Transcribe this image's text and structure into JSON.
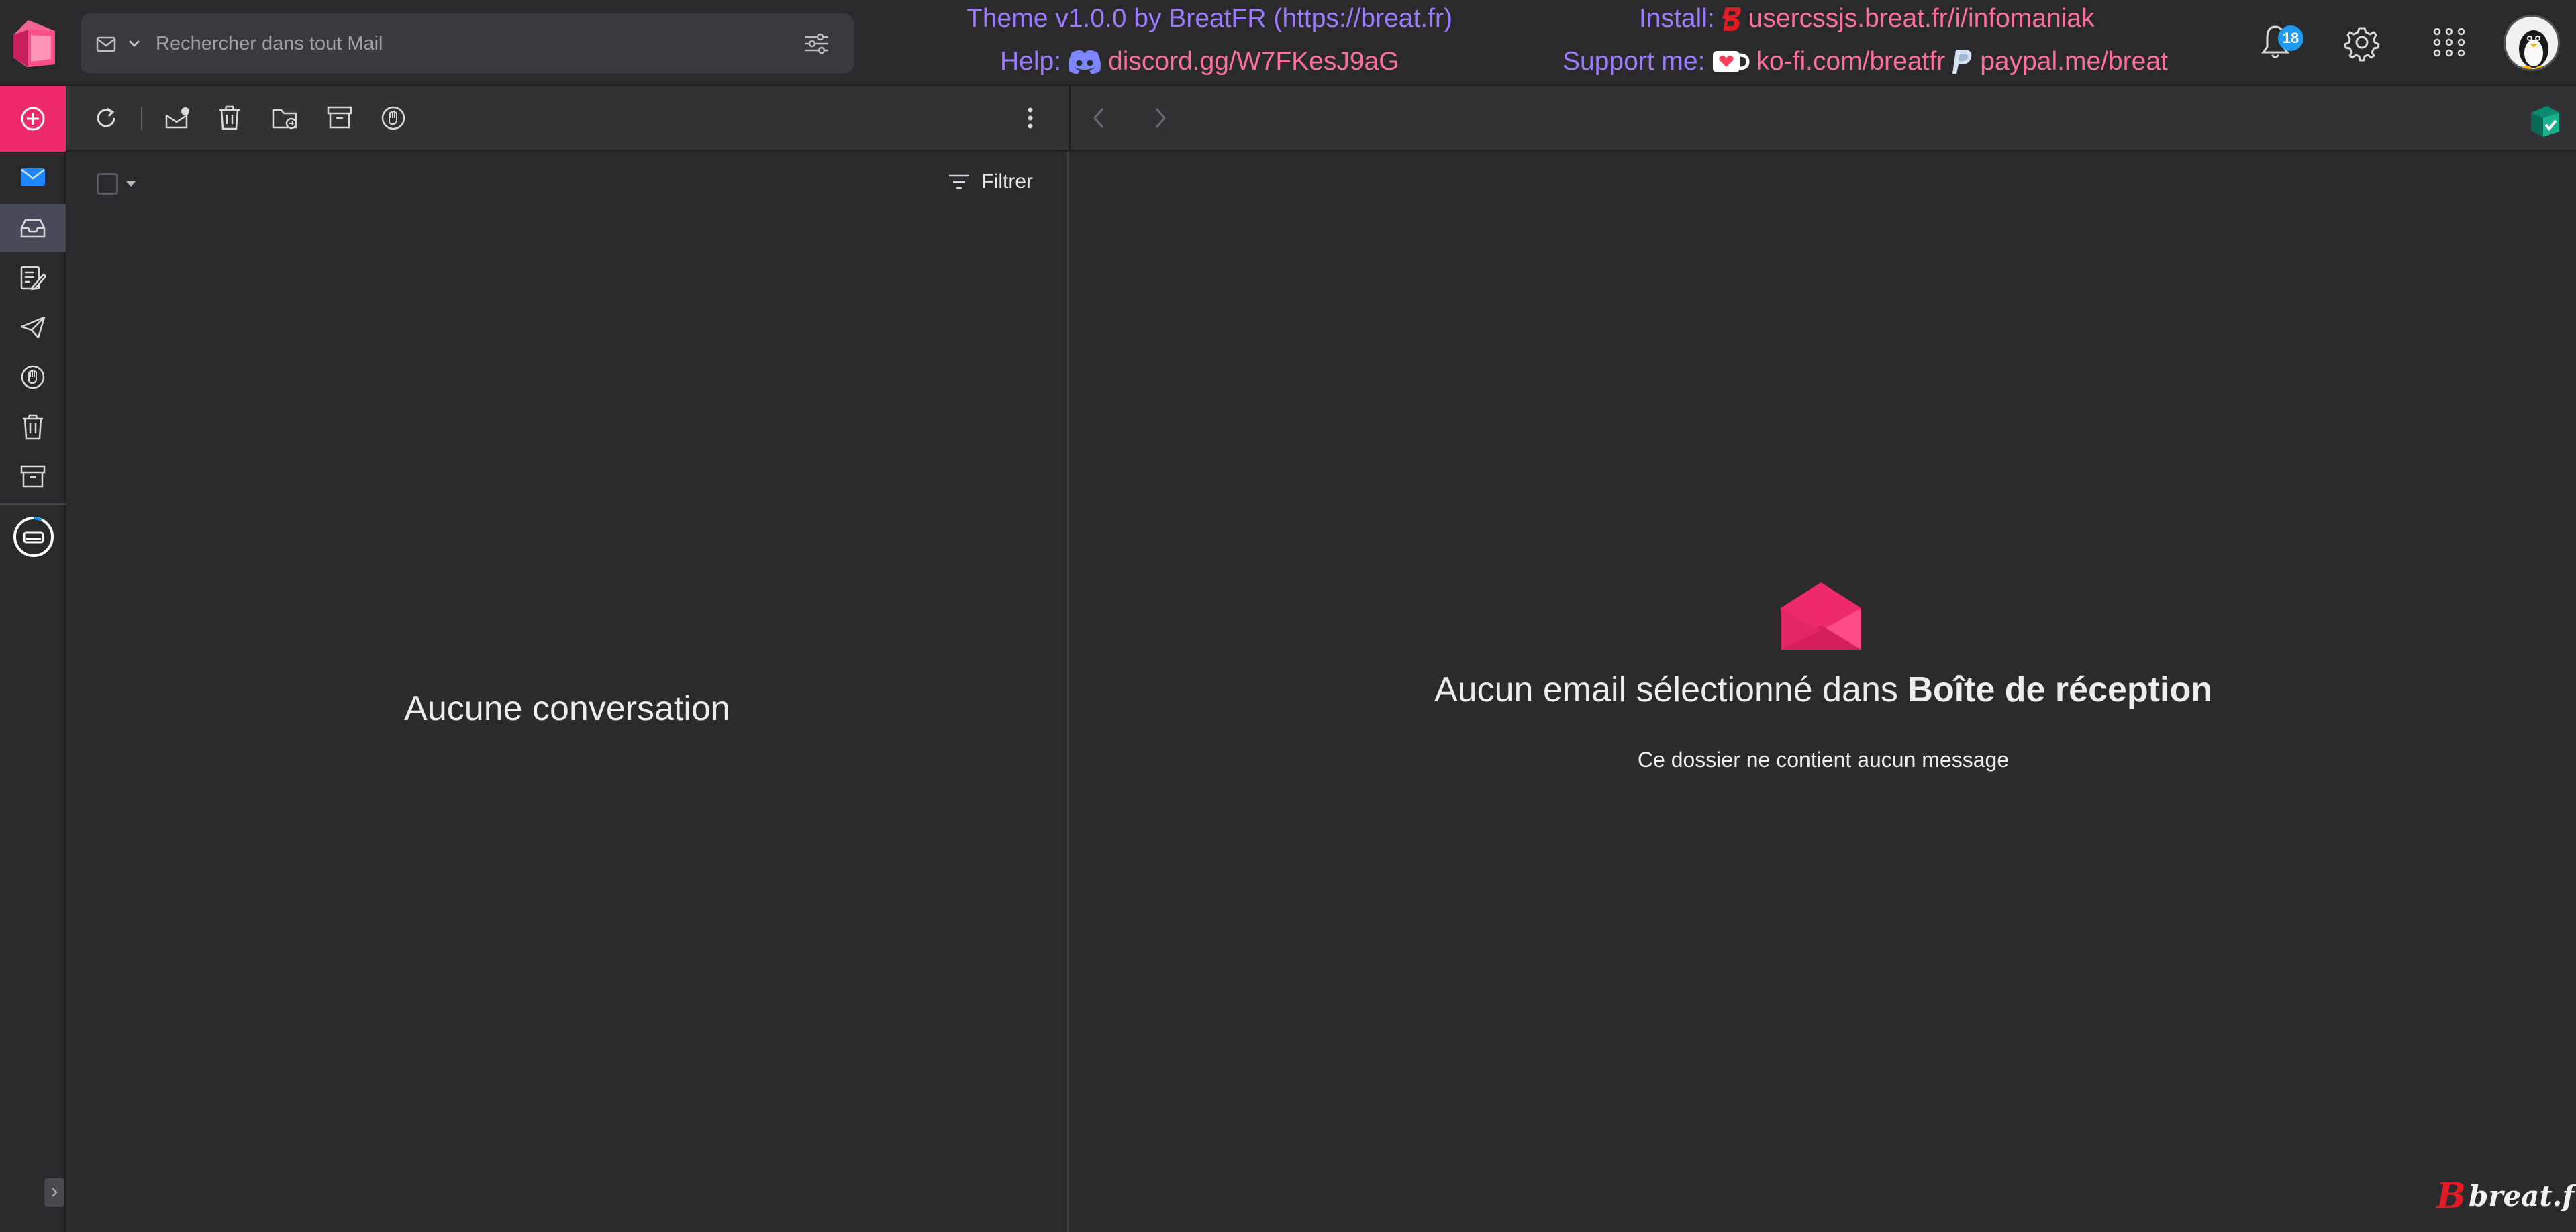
{
  "search": {
    "placeholder": "Rechercher dans tout Mail"
  },
  "credits": {
    "theme": "Theme v1.0.0 by BreatFR (https://breat.fr)",
    "help_label": "Help:",
    "help_link": "discord.gg/W7FKesJ9aG",
    "install_label": "Install:",
    "install_link": "usercssjs.breat.fr/i/infomaniak",
    "support_label": "Support me:",
    "kofi_link": "ko-fi.com/breatfr",
    "paypal_link": "paypal.me/breat"
  },
  "header": {
    "notification_count": "18"
  },
  "list": {
    "filter_label": "Filtrer",
    "empty_text": "Aucune conversation"
  },
  "reader": {
    "title_prefix": "Aucun email sélectionné dans",
    "folder_name": "Boîte de réception",
    "subtitle": "Ce dossier ne contient aucun message"
  },
  "watermark": {
    "text": "breat.fr",
    "initial": "B"
  },
  "colors": {
    "accent": "#ee2a6e",
    "credit_label": "#9d7bff",
    "credit_link": "#ff6f9d",
    "badge": "#1e9bf0"
  },
  "icons": {
    "rail": [
      "mail-icon",
      "inbox-icon",
      "drafts-icon",
      "sent-icon",
      "spam-icon",
      "trash-icon",
      "archive-icon"
    ],
    "toolbar": [
      "refresh-icon",
      "mark-read-icon",
      "delete-icon",
      "move-folder-icon",
      "archive-icon",
      "spam-icon",
      "more-vertical-icon"
    ]
  }
}
